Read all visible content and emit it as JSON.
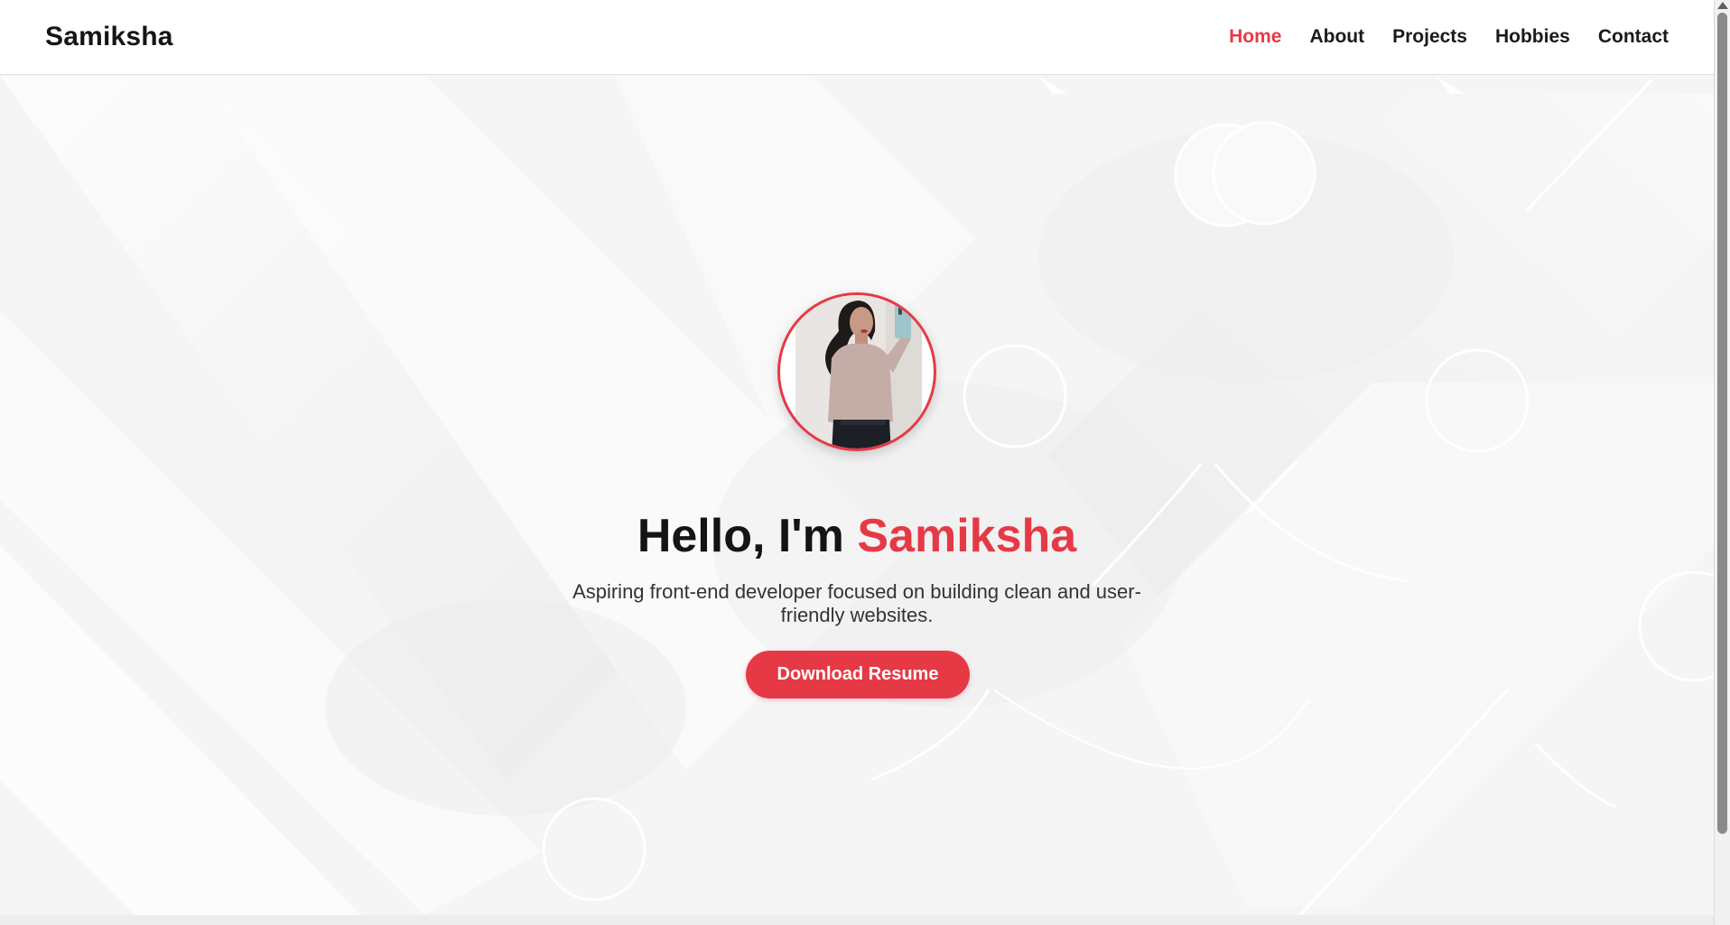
{
  "header": {
    "brand": "Samiksha",
    "nav": [
      {
        "label": "Home",
        "active": true
      },
      {
        "label": "About",
        "active": false
      },
      {
        "label": "Projects",
        "active": false
      },
      {
        "label": "Hobbies",
        "active": false
      },
      {
        "label": "Contact",
        "active": false
      }
    ]
  },
  "hero": {
    "greeting": "Hello, I'm ",
    "name": "Samiksha",
    "tagline": "Aspiring front-end developer focused on building clean and user-friendly websites.",
    "cta_label": "Download Resume"
  },
  "colors": {
    "accent": "#e63946",
    "text": "#141414",
    "header_bg": "#ffffff",
    "hero_bg": "#f6f6f6"
  },
  "icons": {
    "avatar": "profile-photo",
    "scroll": "scroll-up-arrow-icon"
  }
}
